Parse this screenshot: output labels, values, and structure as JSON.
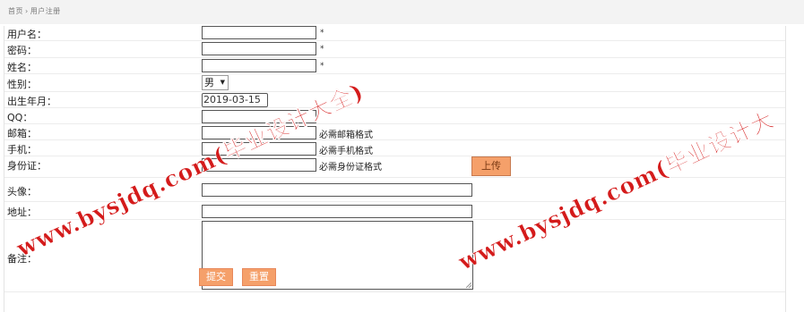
{
  "breadcrumb": {
    "home": "首页",
    "current": "用户注册"
  },
  "form": {
    "fields": [
      {
        "label": "用户名：",
        "value": "",
        "required_mark": "*"
      },
      {
        "label": "密码：",
        "value": "",
        "required_mark": "*"
      },
      {
        "label": "姓名：",
        "value": "",
        "required_mark": "*"
      },
      {
        "label": "性别：",
        "selected": "男",
        "caret": "▼"
      },
      {
        "label": "出生年月：",
        "value": "2019-03-15"
      },
      {
        "label": "QQ：",
        "value": ""
      },
      {
        "label": "邮箱：",
        "value": "",
        "hint": "必需邮箱格式"
      },
      {
        "label": "手机：",
        "value": "",
        "hint": "必需手机格式"
      },
      {
        "label": "身份证：",
        "value": "",
        "hint": "必需身份证格式"
      },
      {
        "label": "头像：",
        "value": "",
        "button": "上传"
      },
      {
        "label": "地址：",
        "value": ""
      },
      {
        "label": "备注：",
        "value": ""
      }
    ],
    "submit_label": "提交",
    "reset_label": "重置"
  },
  "watermark": {
    "text": "www.bysjdq.com(毕业设计大全)",
    "text_right": "www.bysjdq.com(毕业设计大",
    "color": "#d41b1b"
  },
  "colors": {
    "button_bg": "#f5a06a",
    "topbar_bg": "#f3f3f3"
  }
}
